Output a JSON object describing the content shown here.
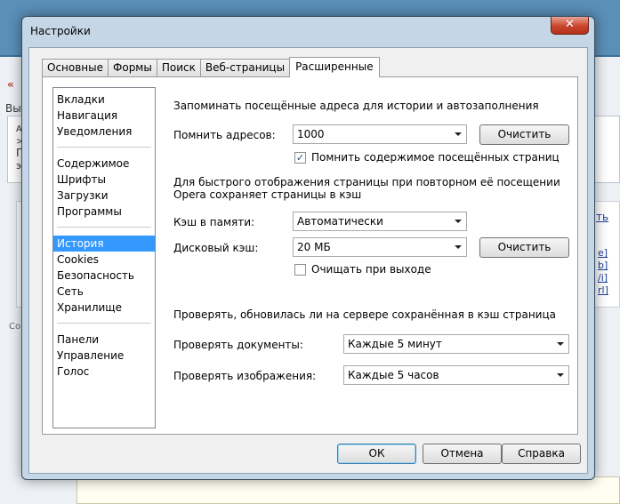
{
  "background": {
    "lines": [
      "«",
      "Вы",
      "А",
      ">",
      "П",
      "эт",
      "Со"
    ],
    "links": [
      "ть",
      "е]",
      "b]",
      "/i]",
      "rl]"
    ]
  },
  "window": {
    "title": "Настройки",
    "close_symbol": "✕"
  },
  "tabs": [
    {
      "label": "Основные"
    },
    {
      "label": "Формы"
    },
    {
      "label": "Поиск"
    },
    {
      "label": "Веб-страницы"
    },
    {
      "label": "Расширенные"
    }
  ],
  "sidebar": {
    "groups": [
      [
        "Вкладки",
        "Навигация",
        "Уведомления"
      ],
      [
        "Содержимое",
        "Шрифты",
        "Загрузки",
        "Программы"
      ],
      [
        "История",
        "Cookies",
        "Безопасность",
        "Сеть",
        "Хранилище"
      ],
      [
        "Панели",
        "Управление",
        "Голос"
      ]
    ],
    "selected": "История"
  },
  "history": {
    "section_title": "Запоминать посещённые адреса для истории и автозаполнения",
    "remember_label": "Помнить адресов:",
    "remember_value": "1000",
    "clear_label": "Очистить",
    "remember_content_label": "Помнить содержимое посещённых страниц",
    "remember_content_checked": true
  },
  "cache": {
    "info_line1": "Для быстрого отображения страницы при повторном её посещении",
    "info_line2": "Opera сохраняет страницы в кэш",
    "memory_label": "Кэш в памяти:",
    "memory_value": "Автоматически",
    "disk_label": "Дисковый кэш:",
    "disk_value": "20 МБ",
    "clear_label": "Очистить",
    "clear_on_exit_label": "Очищать при выходе",
    "clear_on_exit_checked": false
  },
  "check": {
    "section_title": "Проверять, обновилась ли на сервере сохранённая в кэш страница",
    "documents_label": "Проверять документы:",
    "documents_value": "Каждые 5 минут",
    "images_label": "Проверять изображения:",
    "images_value": "Каждые 5 часов"
  },
  "buttons": {
    "ok": "ОК",
    "cancel": "Отмена",
    "help": "Справка"
  }
}
